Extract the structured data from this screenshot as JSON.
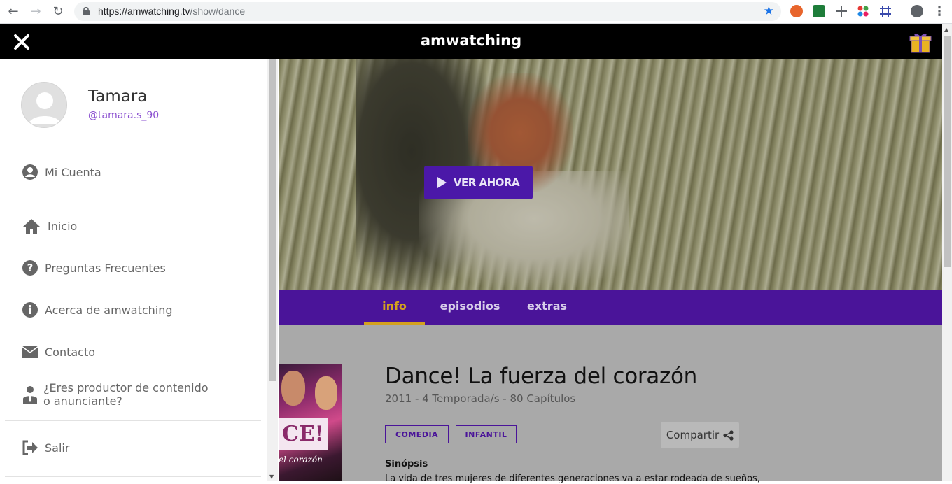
{
  "browser": {
    "url_domain": "https://amwatching.tv",
    "url_path": "/show/dance"
  },
  "app": {
    "brand": "amwatching"
  },
  "sidebar": {
    "user_name": "Tamara",
    "user_handle": "@tamara.s_90",
    "items": [
      {
        "label": "Mi Cuenta",
        "icon": "account-circle-icon"
      },
      {
        "label": "Inicio",
        "icon": "home-icon"
      },
      {
        "label": "Preguntas Frecuentes",
        "icon": "help-circle-icon"
      },
      {
        "label": "Acerca de amwatching",
        "icon": "info-circle-icon"
      },
      {
        "label": "Contacto",
        "icon": "envelope-icon"
      },
      {
        "label": "¿Eres productor de contenido",
        "label2": "o anunciante?",
        "icon": "businessman-icon"
      },
      {
        "label": "Salir",
        "icon": "sign-out-icon"
      }
    ]
  },
  "hero": {
    "play_label": "VER AHORA"
  },
  "tabs": [
    {
      "label": "info",
      "active": true
    },
    {
      "label": "episodios",
      "active": false
    },
    {
      "label": "extras",
      "active": false
    }
  ],
  "show": {
    "title": "Dance! La fuerza del corazón",
    "meta": "2011 - 4 Temporada/s - 80 Capítulos",
    "tags": [
      "COMEDIA",
      "INFANTIL"
    ],
    "share_label": "Compartir",
    "synopsis_title": "Sinópsis",
    "synopsis_text": "La vida de tres mujeres de diferentes generaciones va a estar rodeada de sueños,",
    "poster_logo": "CE!",
    "poster_subtitle": "el corazón"
  },
  "colors": {
    "accent": "#4a1499",
    "tab_active": "#d4a11e",
    "handle": "#8a4fd0"
  }
}
